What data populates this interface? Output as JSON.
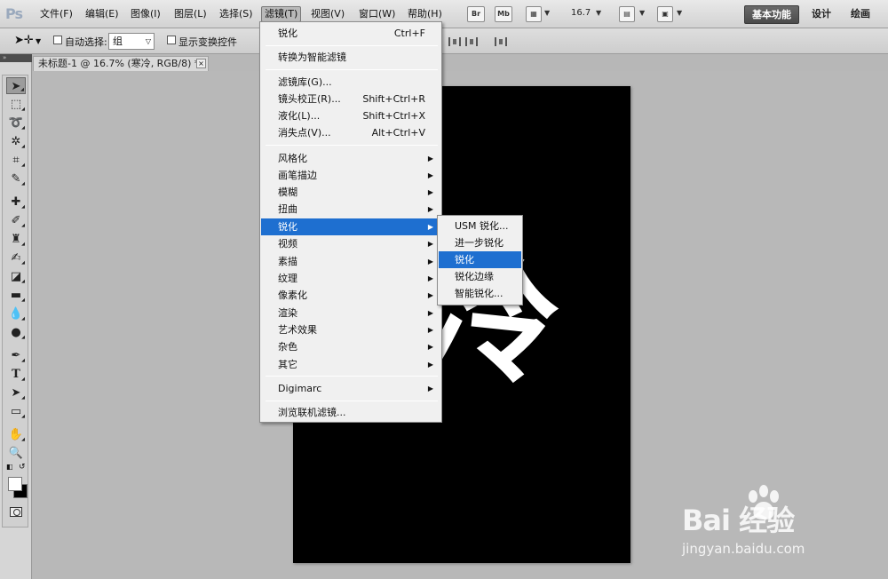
{
  "app": {
    "logo": "Ps",
    "menu": [
      "文件(F)",
      "编辑(E)",
      "图像(I)",
      "图层(L)",
      "选择(S)",
      "滤镜(T)",
      "视图(V)",
      "窗口(W)",
      "帮助(H)"
    ],
    "bridge_label": "Br",
    "minibridge_label": "Mb",
    "zoom": "16.7",
    "workspaces": [
      "基本功能",
      "设计",
      "绘画"
    ]
  },
  "options": {
    "auto_select_label": "自动选择:",
    "auto_select_value": "组",
    "show_transform_label": "显示变换控件"
  },
  "document": {
    "tab_title": "未标题-1 @ 16.7% (寒冷, RGB/8) *",
    "close_label": "×",
    "canvas_text": "冷"
  },
  "filter_menu": {
    "items": [
      {
        "label": "锐化",
        "shortcut": "Ctrl+F"
      },
      {
        "label": "转换为智能滤镜"
      },
      {
        "label": "滤镜库(G)..."
      },
      {
        "label": "镜头校正(R)...",
        "shortcut": "Shift+Ctrl+R"
      },
      {
        "label": "液化(L)...",
        "shortcut": "Shift+Ctrl+X"
      },
      {
        "label": "消失点(V)...",
        "shortcut": "Alt+Ctrl+V"
      },
      {
        "label": "风格化"
      },
      {
        "label": "画笔描边"
      },
      {
        "label": "模糊"
      },
      {
        "label": "扭曲"
      },
      {
        "label": "锐化"
      },
      {
        "label": "视频"
      },
      {
        "label": "素描"
      },
      {
        "label": "纹理"
      },
      {
        "label": "像素化"
      },
      {
        "label": "渲染"
      },
      {
        "label": "艺术效果"
      },
      {
        "label": "杂色"
      },
      {
        "label": "其它"
      },
      {
        "label": "Digimarc"
      },
      {
        "label": "浏览联机滤镜..."
      }
    ]
  },
  "sharpen_submenu": {
    "items": [
      "USM 锐化...",
      "进一步锐化",
      "锐化",
      "锐化边缘",
      "智能锐化..."
    ]
  },
  "watermark": {
    "brand": "Bai  经验",
    "url": "jingyan.baidu.com"
  },
  "icons": {
    "move": "move-icon",
    "marquee": "marquee-icon",
    "lasso": "lasso-icon"
  }
}
